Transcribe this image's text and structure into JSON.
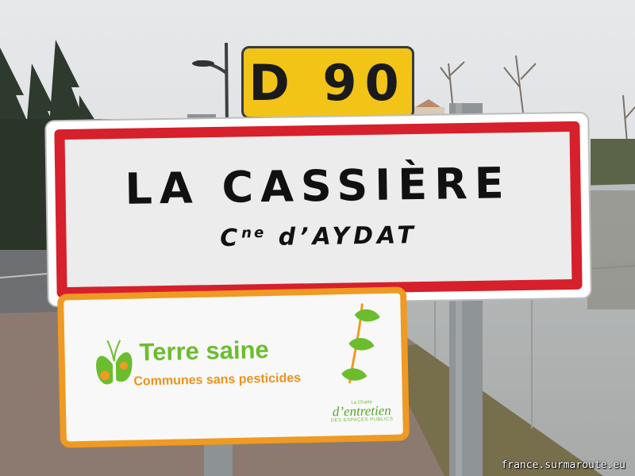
{
  "road_number": "D 90",
  "town_sign": {
    "name": "LA CASSIÈRE",
    "commune_prefix": "C",
    "commune_suffix": "ne",
    "commune_name": "d’AYDAT"
  },
  "eco_sign": {
    "title": "Terre saine",
    "subtitle": "Communes sans pesticides",
    "charter_top": "La Charte",
    "charter_main": "d’entretien",
    "charter_bottom": "DES ESPACES PUBLICS"
  },
  "watermark": "france.surmaroute.eu",
  "colors": {
    "sign_red": "#d6202b",
    "plate_yellow": "#f2c417",
    "eco_green": "#6bbd2e",
    "eco_orange": "#ef9a22"
  }
}
